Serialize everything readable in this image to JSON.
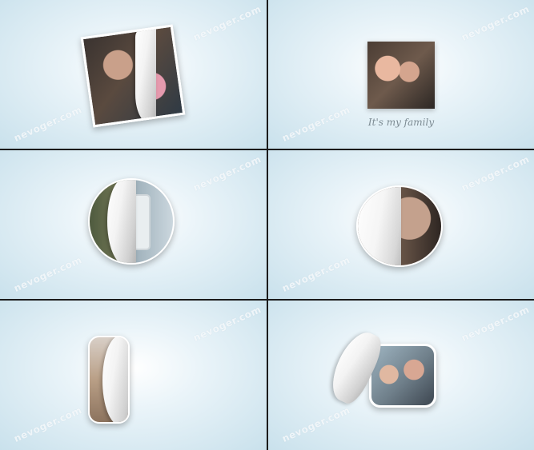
{
  "watermark": "nevoger.com",
  "caption": "It's my family",
  "panels": [
    {
      "shape": "square-tilted",
      "effect": "page-curl"
    },
    {
      "shape": "square",
      "effect": "none"
    },
    {
      "shape": "circle",
      "effect": "page-curl"
    },
    {
      "shape": "circle",
      "effect": "page-curl"
    },
    {
      "shape": "rounded-rect",
      "effect": "page-curl"
    },
    {
      "shape": "rounded-rect",
      "effect": "page-curl"
    }
  ],
  "colors": {
    "background_center": "#ffffff",
    "background_edge": "#c9e1ec",
    "divider": "#1b1b1b",
    "caption": "#7c8a92"
  }
}
